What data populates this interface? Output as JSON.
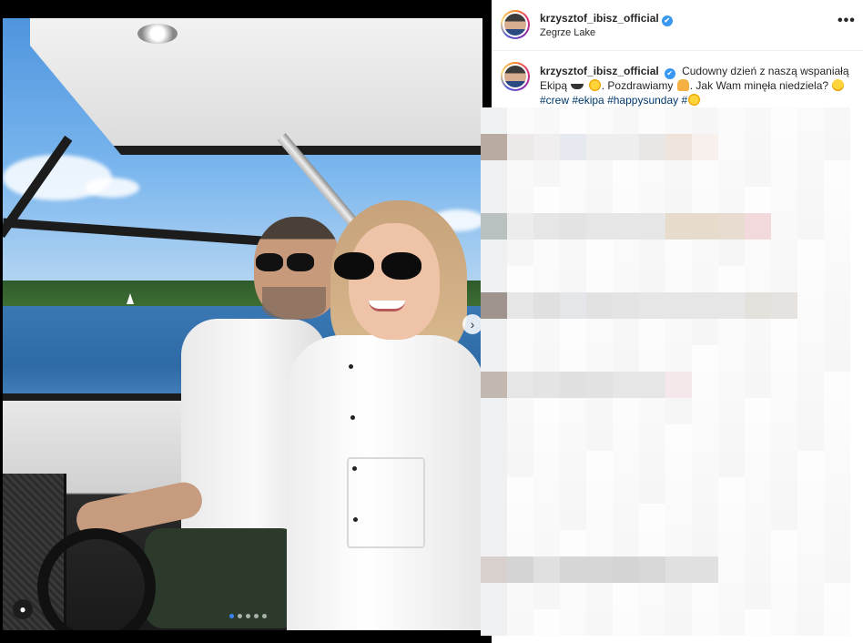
{
  "post": {
    "username": "krzysztof_ibisz_official",
    "verified_icon": "✔",
    "location": "Zegrze Lake",
    "more_label": "•••"
  },
  "caption": {
    "username": "krzysztof_ibisz_official",
    "text_1": "Cudowny dzień z naszą wspaniałą Ekipą",
    "text_2": ". Pozdrawiamy",
    "text_3": ". Jak Wam minęła niedziela?",
    "hashtags": [
      "#crew",
      "#ekipa",
      "#happysunday",
      "#"
    ]
  },
  "carousel": {
    "next_label": "›",
    "tag_label": "👤",
    "dots": 5,
    "active_dot": 0
  },
  "colors": {
    "link": "#00376b",
    "verified": "#3897f0",
    "text": "#262626"
  }
}
